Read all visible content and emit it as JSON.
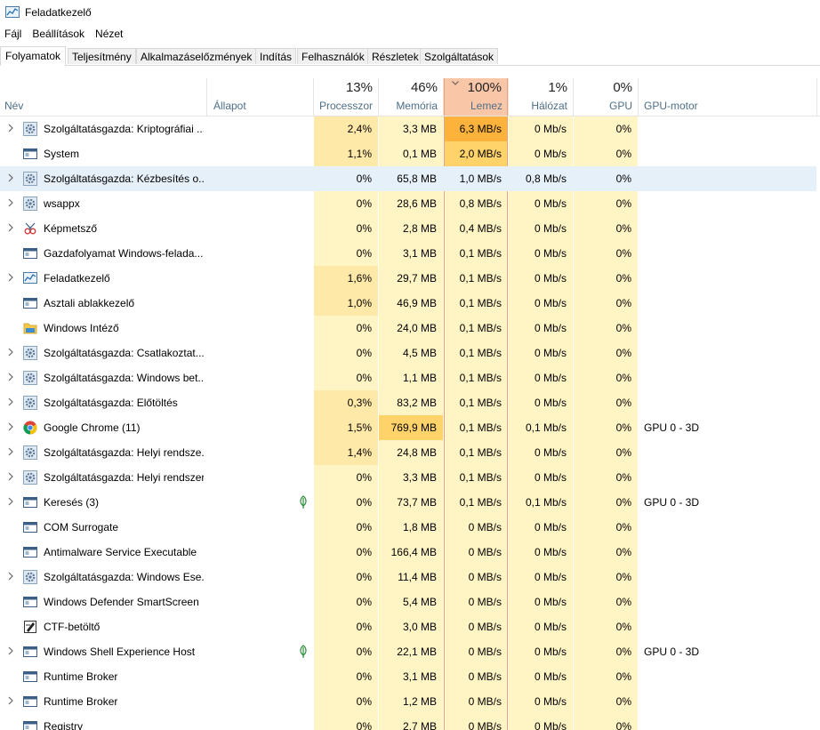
{
  "window": {
    "title": "Feladatkezelő",
    "icon": "task-manager-icon"
  },
  "menu": [
    "Fájl",
    "Beállítások",
    "Nézet"
  ],
  "tabs": [
    {
      "label": "Folyamatok",
      "active": true
    },
    {
      "label": "Teljesítmény"
    },
    {
      "label": "Alkalmazáselőzmények"
    },
    {
      "label": "Indítás"
    },
    {
      "label": "Felhasználók"
    },
    {
      "label": "Részletek"
    },
    {
      "label": "Szolgáltatások"
    }
  ],
  "columns": {
    "name": "Név",
    "status": "Állapot",
    "cpu": {
      "label": "Processzor",
      "total": "13%"
    },
    "memory": {
      "label": "Memória",
      "total": "46%"
    },
    "disk": {
      "label": "Lemez",
      "total": "100%"
    },
    "network": {
      "label": "Hálózat",
      "total": "1%"
    },
    "gpu": {
      "label": "GPU",
      "total": "0%"
    },
    "gpu_engine": "GPU-motor",
    "sort_indicator": "chevron-down-icon"
  },
  "colors": {
    "light_heat": "#fff4c4",
    "medium_heat": "#ffe9a8",
    "strong_heat": "#ffd26a",
    "disk_high": "#fcb23b",
    "disk_header": "#f9c7a8",
    "disk_border": "#f0a070",
    "selection": "#e6f0f9",
    "header_label": "#4d6e87"
  },
  "processes": [
    {
      "name": "Szolgáltatásgazda: Kriptográfiai ...",
      "icon": "gear-icon",
      "expandable": true,
      "cpu": "2,4%",
      "memory": "3,3 MB",
      "disk": "6,3 MB/s",
      "network": "0 Mb/s",
      "gpu": "0%",
      "gpu_engine": "",
      "disk_level": "high"
    },
    {
      "name": "System",
      "icon": "window-icon",
      "expandable": false,
      "cpu": "1,1%",
      "memory": "0,1 MB",
      "disk": "2,0 MB/s",
      "network": "0 Mb/s",
      "gpu": "0%",
      "gpu_engine": "",
      "disk_level": "medium"
    },
    {
      "name": "Szolgáltatásgazda: Kézbesítés o...",
      "icon": "gear-icon",
      "expandable": true,
      "selected": true,
      "cpu": "0%",
      "memory": "65,8 MB",
      "disk": "1,0 MB/s",
      "network": "0,8 Mb/s",
      "gpu": "0%",
      "gpu_engine": ""
    },
    {
      "name": "wsappx",
      "icon": "gear-icon",
      "expandable": true,
      "cpu": "0%",
      "memory": "28,6 MB",
      "disk": "0,8 MB/s",
      "network": "0 Mb/s",
      "gpu": "0%",
      "gpu_engine": ""
    },
    {
      "name": "Képmetsző",
      "icon": "snipping-tool-icon",
      "expandable": true,
      "cpu": "0%",
      "memory": "2,8 MB",
      "disk": "0,4 MB/s",
      "network": "0 Mb/s",
      "gpu": "0%",
      "gpu_engine": ""
    },
    {
      "name": "Gazdafolyamat Windows-felada...",
      "icon": "window-icon",
      "expandable": false,
      "cpu": "0%",
      "memory": "3,1 MB",
      "disk": "0,1 MB/s",
      "network": "0 Mb/s",
      "gpu": "0%",
      "gpu_engine": ""
    },
    {
      "name": "Feladatkezelő",
      "icon": "task-manager-icon",
      "expandable": true,
      "cpu": "1,6%",
      "memory": "29,7 MB",
      "disk": "0,1 MB/s",
      "network": "0 Mb/s",
      "gpu": "0%",
      "gpu_engine": ""
    },
    {
      "name": "Asztali ablakkezelő",
      "icon": "window-icon",
      "expandable": false,
      "cpu": "1,0%",
      "memory": "46,9 MB",
      "disk": "0,1 MB/s",
      "network": "0 Mb/s",
      "gpu": "0%",
      "gpu_engine": ""
    },
    {
      "name": "Windows Intéző",
      "icon": "folder-icon",
      "expandable": false,
      "cpu": "0%",
      "memory": "24,0 MB",
      "disk": "0,1 MB/s",
      "network": "0 Mb/s",
      "gpu": "0%",
      "gpu_engine": ""
    },
    {
      "name": "Szolgáltatásgazda: Csatlakoztat...",
      "icon": "gear-icon",
      "expandable": true,
      "cpu": "0%",
      "memory": "4,5 MB",
      "disk": "0,1 MB/s",
      "network": "0 Mb/s",
      "gpu": "0%",
      "gpu_engine": ""
    },
    {
      "name": "Szolgáltatásgazda: Windows bet...",
      "icon": "gear-icon",
      "expandable": true,
      "cpu": "0%",
      "memory": "1,1 MB",
      "disk": "0,1 MB/s",
      "network": "0 Mb/s",
      "gpu": "0%",
      "gpu_engine": ""
    },
    {
      "name": "Szolgáltatásgazda: Előtöltés",
      "icon": "gear-icon",
      "expandable": true,
      "cpu": "0,3%",
      "memory": "83,2 MB",
      "disk": "0,1 MB/s",
      "network": "0 Mb/s",
      "gpu": "0%",
      "gpu_engine": ""
    },
    {
      "name": "Google Chrome (11)",
      "icon": "chrome-icon",
      "expandable": true,
      "cpu": "1,5%",
      "memory": "769,9 MB",
      "disk": "0,1 MB/s",
      "network": "0,1 Mb/s",
      "gpu": "0%",
      "gpu_engine": "GPU 0 - 3D",
      "memory_level": "high"
    },
    {
      "name": "Szolgáltatásgazda: Helyi rendsze...",
      "icon": "gear-icon",
      "expandable": true,
      "cpu": "1,4%",
      "memory": "24,8 MB",
      "disk": "0,1 MB/s",
      "network": "0 Mb/s",
      "gpu": "0%",
      "gpu_engine": ""
    },
    {
      "name": "Szolgáltatásgazda: Helyi rendszer",
      "icon": "gear-icon",
      "expandable": true,
      "cpu": "0%",
      "memory": "3,3 MB",
      "disk": "0,1 MB/s",
      "network": "0 Mb/s",
      "gpu": "0%",
      "gpu_engine": ""
    },
    {
      "name": "Keresés (3)",
      "icon": "window-icon",
      "expandable": true,
      "suspended": true,
      "cpu": "0%",
      "memory": "73,7 MB",
      "disk": "0,1 MB/s",
      "network": "0,1 Mb/s",
      "gpu": "0%",
      "gpu_engine": "GPU 0 - 3D"
    },
    {
      "name": "COM Surrogate",
      "icon": "window-icon",
      "expandable": false,
      "cpu": "0%",
      "memory": "1,8 MB",
      "disk": "0 MB/s",
      "network": "0 Mb/s",
      "gpu": "0%",
      "gpu_engine": ""
    },
    {
      "name": "Antimalware Service Executable",
      "icon": "window-icon",
      "expandable": false,
      "cpu": "0%",
      "memory": "166,4 MB",
      "disk": "0 MB/s",
      "network": "0 Mb/s",
      "gpu": "0%",
      "gpu_engine": ""
    },
    {
      "name": "Szolgáltatásgazda: Windows Ese...",
      "icon": "gear-icon",
      "expandable": true,
      "cpu": "0%",
      "memory": "11,4 MB",
      "disk": "0 MB/s",
      "network": "0 Mb/s",
      "gpu": "0%",
      "gpu_engine": ""
    },
    {
      "name": "Windows Defender SmartScreen",
      "icon": "window-icon",
      "expandable": false,
      "cpu": "0%",
      "memory": "5,4 MB",
      "disk": "0 MB/s",
      "network": "0 Mb/s",
      "gpu": "0%",
      "gpu_engine": ""
    },
    {
      "name": "CTF-betöltő",
      "icon": "ctf-pen-icon",
      "expandable": false,
      "cpu": "0%",
      "memory": "3,0 MB",
      "disk": "0 MB/s",
      "network": "0 Mb/s",
      "gpu": "0%",
      "gpu_engine": ""
    },
    {
      "name": "Windows Shell Experience Host",
      "icon": "window-icon",
      "expandable": true,
      "suspended": true,
      "cpu": "0%",
      "memory": "22,1 MB",
      "disk": "0 MB/s",
      "network": "0 Mb/s",
      "gpu": "0%",
      "gpu_engine": "GPU 0 - 3D"
    },
    {
      "name": "Runtime Broker",
      "icon": "window-icon",
      "expandable": false,
      "cpu": "0%",
      "memory": "3,1 MB",
      "disk": "0 MB/s",
      "network": "0 Mb/s",
      "gpu": "0%",
      "gpu_engine": ""
    },
    {
      "name": "Runtime Broker",
      "icon": "window-icon",
      "expandable": true,
      "cpu": "0%",
      "memory": "1,2 MB",
      "disk": "0 MB/s",
      "network": "0 Mb/s",
      "gpu": "0%",
      "gpu_engine": ""
    },
    {
      "name": "Registry",
      "icon": "window-icon",
      "expandable": false,
      "cpu": "0%",
      "memory": "2,7 MB",
      "disk": "0 MB/s",
      "network": "0 Mb/s",
      "gpu": "0%",
      "gpu_engine": ""
    }
  ]
}
